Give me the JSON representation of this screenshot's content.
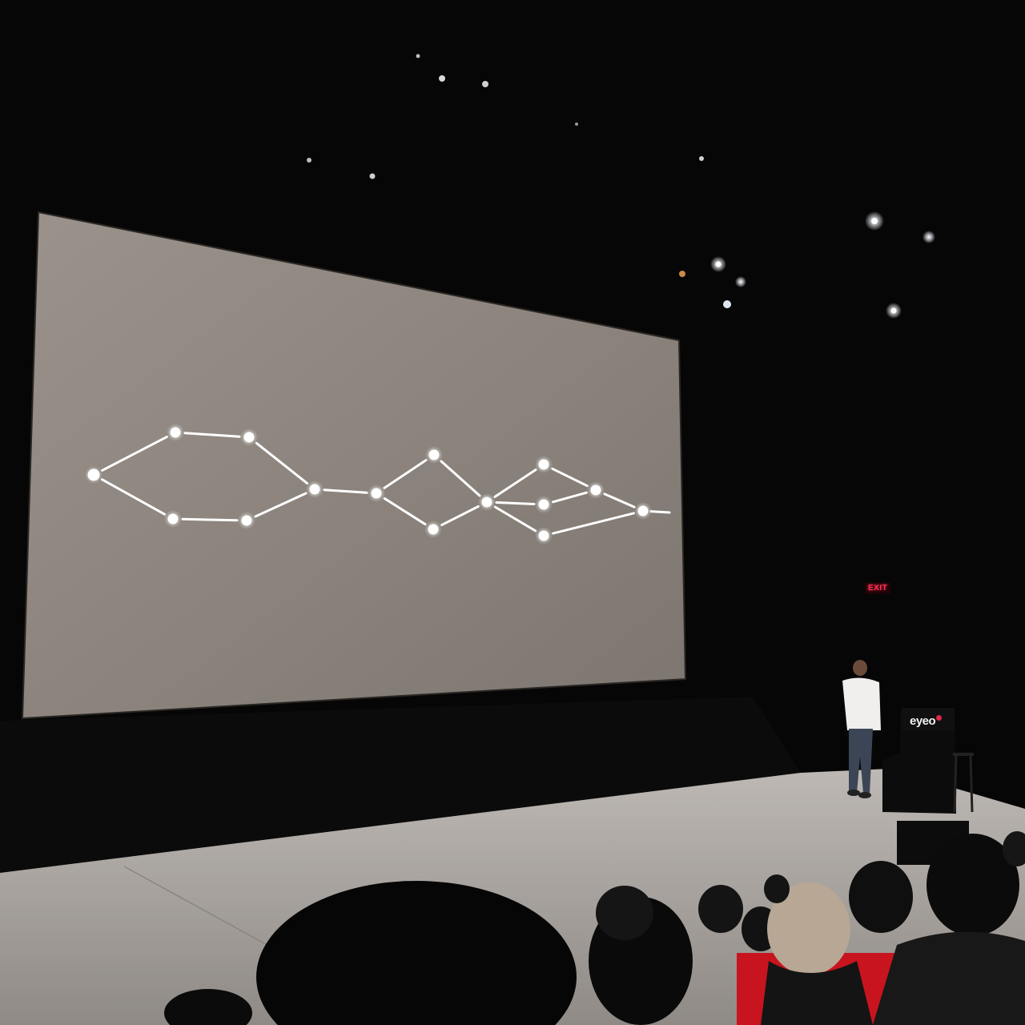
{
  "podium": {
    "brand_text": "eyeo"
  },
  "exit_sign": {
    "text": "EXIT"
  },
  "slide": {
    "nodes": [
      {
        "id": "n1"
      },
      {
        "id": "n2"
      },
      {
        "id": "n3"
      },
      {
        "id": "n4"
      },
      {
        "id": "n5"
      },
      {
        "id": "n6"
      },
      {
        "id": "n7"
      },
      {
        "id": "n8"
      },
      {
        "id": "n9"
      },
      {
        "id": "n10"
      },
      {
        "id": "n11"
      },
      {
        "id": "n12"
      },
      {
        "id": "n13"
      },
      {
        "id": "n14"
      },
      {
        "id": "n15"
      },
      {
        "id": "n16"
      }
    ],
    "edges": [
      [
        "n1",
        "n2"
      ],
      [
        "n1",
        "n3"
      ],
      [
        "n2",
        "n4"
      ],
      [
        "n3",
        "n5"
      ],
      [
        "n4",
        "n6"
      ],
      [
        "n5",
        "n6"
      ],
      [
        "n6",
        "n7"
      ],
      [
        "n7",
        "n8"
      ],
      [
        "n7",
        "n9"
      ],
      [
        "n8",
        "n10"
      ],
      [
        "n9",
        "n10"
      ],
      [
        "n10",
        "n11"
      ],
      [
        "n10",
        "n12"
      ],
      [
        "n10",
        "n13"
      ],
      [
        "n11",
        "n14"
      ],
      [
        "n12",
        "n14"
      ],
      [
        "n14",
        "n15"
      ],
      [
        "n13",
        "n15"
      ],
      [
        "n15",
        "n16"
      ]
    ]
  },
  "colors": {
    "screen": "#8f8780",
    "stage_floor": "#a8a29d",
    "node": "#ffffff",
    "seat_red": "#c8141e",
    "accent_logo_dot": "#e0284a"
  }
}
